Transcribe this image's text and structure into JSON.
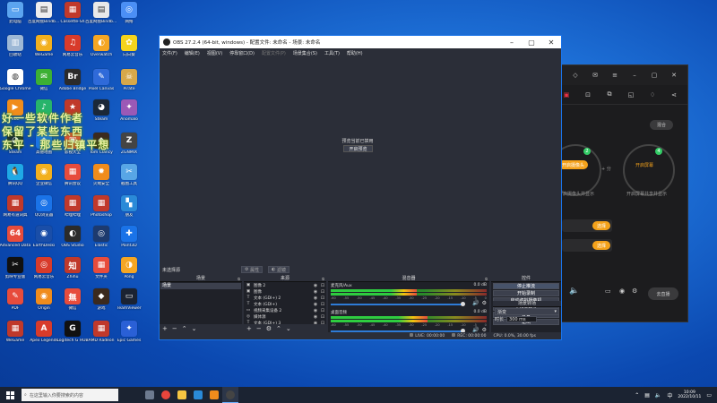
{
  "desktop": {
    "overlay_text": [
      "好一些软件作者",
      "保留了某些东西",
      "东平 - 那些归镇平想"
    ],
    "icons": [
      {
        "label": "此电脑",
        "color": "#5ba4f0",
        "glyph": "▭"
      },
      {
        "label": "百度网盘Bindbgm",
        "color": "#eee",
        "glyph": "▤"
      },
      {
        "label": "Cassette-Sh",
        "color": "#c0392b",
        "glyph": "▦"
      },
      {
        "label": "百度网盘Bindbgm",
        "color": "#e9e9e9",
        "glyph": "▤"
      },
      {
        "label": "网络",
        "color": "#4b8ff5",
        "glyph": "◎"
      },
      {
        "label": "回收站",
        "color": "#9db8d6",
        "glyph": "▥"
      },
      {
        "label": "WeGame",
        "color": "#f2b01e",
        "glyph": "◉"
      },
      {
        "label": "网易云音乐",
        "color": "#d83b2b",
        "glyph": "♫"
      },
      {
        "label": "Overwatch",
        "color": "#f5a623",
        "glyph": "◐"
      },
      {
        "label": "向日葵",
        "color": "#f5d41d",
        "glyph": "✿"
      },
      {
        "label": "Google Chrome",
        "color": "#ffffff",
        "glyph": "◍"
      },
      {
        "label": "微信",
        "color": "#3cb034",
        "glyph": "✉"
      },
      {
        "label": "Adobe Bridge",
        "color": "#2b2b2b",
        "glyph": "Br"
      },
      {
        "label": "Pixel Canvas",
        "color": "#2f6ad9",
        "glyph": "✎"
      },
      {
        "label": "Pirate",
        "color": "#d7a84a",
        "glyph": "☠"
      },
      {
        "label": "VLC",
        "color": "#f08c1c",
        "glyph": "▶"
      },
      {
        "label": "QQ音乐",
        "color": "#27b46b",
        "glyph": "♪"
      },
      {
        "label": "红色警戒",
        "color": "#c0392b",
        "glyph": "★"
      },
      {
        "label": "Steam",
        "color": "#1b2838",
        "glyph": "◕"
      },
      {
        "label": "Anomalo",
        "color": "#9b59b6",
        "glyph": "✦"
      },
      {
        "label": "Steam",
        "color": "#1b2838",
        "glyph": "◕"
      },
      {
        "label": "高德地图",
        "color": "#1a73e8",
        "glyph": "⌖"
      },
      {
        "label": "影视大全",
        "color": "#e74c3c",
        "glyph": "▣"
      },
      {
        "label": "Tom Clancy",
        "color": "#3b2a1e",
        "glyph": "◆"
      },
      {
        "label": "ZGNMIX",
        "color": "#444",
        "glyph": "Z"
      },
      {
        "label": "腾讯QQ",
        "color": "#1fa9e6",
        "glyph": "🐧"
      },
      {
        "label": "企业微信",
        "color": "#f2b01e",
        "glyph": "◉"
      },
      {
        "label": "腾讯会议",
        "color": "#e74c3c",
        "glyph": "▦"
      },
      {
        "label": "火绒安全",
        "color": "#f08c1c",
        "glyph": "✹"
      },
      {
        "label": "截图工具",
        "color": "#58a6e6",
        "glyph": "✂"
      },
      {
        "label": "网易有道词典",
        "color": "#c0392b",
        "glyph": "▦"
      },
      {
        "label": "QQ浏览器",
        "color": "#1a73e8",
        "glyph": "◎"
      },
      {
        "label": "哔哩哔哩",
        "color": "#c0392b",
        "glyph": "▦"
      },
      {
        "label": "Photoshop",
        "color": "#c0392b",
        "glyph": "▦"
      },
      {
        "label": "朋友",
        "color": "#2a8ad8",
        "glyph": "▚"
      },
      {
        "label": "Advanced Data",
        "color": "#e74c3c",
        "glyph": "64"
      },
      {
        "label": "EarthDeski",
        "color": "#1a4ea8",
        "glyph": "◉"
      },
      {
        "label": "OBS Studio",
        "color": "#2b2b2b",
        "glyph": "◐"
      },
      {
        "label": "Elastic",
        "color": "#1d3a6e",
        "glyph": "◎"
      },
      {
        "label": "Paint3D",
        "color": "#1a73e8",
        "glyph": "✚"
      },
      {
        "label": "剪映专业版",
        "color": "#111",
        "glyph": "✂"
      },
      {
        "label": "网易云音乐",
        "color": "#d83b2b",
        "glyph": "◎"
      },
      {
        "label": "Zhihu",
        "color": "#c0392b",
        "glyph": "知"
      },
      {
        "label": "文件夹",
        "color": "#e74c3c",
        "glyph": "▦"
      },
      {
        "label": "Pong",
        "color": "#f5a623",
        "glyph": "◑"
      },
      {
        "label": "PDF",
        "color": "#e74c3c",
        "glyph": "✎"
      },
      {
        "label": "Origin",
        "color": "#f08c1c",
        "glyph": "◉"
      },
      {
        "label": "微信",
        "color": "#e74c3c",
        "glyph": "無"
      },
      {
        "label": "游戏",
        "color": "#3b2a1e",
        "glyph": "◆"
      },
      {
        "label": "TeamViewer",
        "color": "#1b2332",
        "glyph": "▭"
      },
      {
        "label": "WeGame",
        "color": "#c0392b",
        "glyph": "▦"
      },
      {
        "label": "Apex Legends",
        "color": "#d83b2b",
        "glyph": "A"
      },
      {
        "label": "Logitech G HUB",
        "color": "#111",
        "glyph": "G"
      },
      {
        "label": "AMD Radeon",
        "color": "#c0392b",
        "glyph": "▦"
      },
      {
        "label": "Epic Games",
        "color": "#2a60d6",
        "glyph": "✦"
      }
    ]
  },
  "bg_app": {
    "pill": "混合",
    "btn_left": "开启摄像头",
    "btn_right": "开启屏幕",
    "label_left": "开启摄像头并显示",
    "label_right": "开启屏幕共享并显示",
    "option1": "选择",
    "option2": "选择",
    "go_live": "去直播"
  },
  "obs": {
    "title": "OBS 27.2.4 (64-bit, windows) - 配置文件: 未命名 - 场景: 未命名",
    "menu": [
      "文件(F)",
      "编辑(E)",
      "视图(V)",
      "停靠窗口(D)",
      "配置文件(P)",
      "场景集合(S)",
      "工具(T)",
      "帮助(H)"
    ],
    "preview_msg": "预览当前已禁用",
    "preview_btn": "开启预览",
    "no_source": "未选择源",
    "tb_props": "属性",
    "tb_filters": "滤镜",
    "docks": {
      "scenes": "场景",
      "sources": "来源",
      "mixer": "混音器",
      "transitions": "场景转场",
      "controls": "控件"
    },
    "scenes": [
      "场景"
    ],
    "sources": [
      {
        "icon": "▣",
        "name": "图像 2"
      },
      {
        "icon": "▣",
        "name": "图像"
      },
      {
        "icon": "T",
        "name": "文本 (GDI+) 2"
      },
      {
        "icon": "T",
        "name": "文本 (GDI+)"
      },
      {
        "icon": "▭",
        "name": "视频采集设备 2"
      },
      {
        "icon": "◎",
        "name": "媒体源"
      },
      {
        "icon": "T",
        "name": "文本 (GDI+) 3"
      },
      {
        "icon": "▭",
        "name": "显示器采集"
      }
    ],
    "mixer": [
      {
        "name": "麦克风/Aux",
        "db": "0.0 dB",
        "level": 0.55
      },
      {
        "name": "桌面音频",
        "db": "0.0 dB",
        "level": 0.62
      }
    ],
    "meter_scale": [
      "-60",
      "-55",
      "-50",
      "-45",
      "-40",
      "-35",
      "-30",
      "-25",
      "-20",
      "-15",
      "-10",
      "-5",
      "0"
    ],
    "controls": [
      "停止推流",
      "开始录制",
      "启动虚拟摄像机",
      "工作室模式",
      "设置",
      "退出"
    ],
    "transition_type": "渐变",
    "duration_label": "时长",
    "duration_value": "300 ms",
    "status": {
      "live_label": "LIVE:",
      "live_time": "00:00:00",
      "rec_label": "REC:",
      "rec_time": "00:00:00",
      "cpu": "CPU: 0.0%, 30.00 fps"
    }
  },
  "taskbar": {
    "search_placeholder": "在这里输入你要搜索的内容",
    "apps": [
      {
        "name": "task-view",
        "color": "#6d7a8f"
      },
      {
        "name": "chrome",
        "color": "#e8453c"
      },
      {
        "name": "file-explorer",
        "color": "#f5c542"
      },
      {
        "name": "store",
        "color": "#2a8ad8"
      },
      {
        "name": "app-orange",
        "color": "#f08c1c"
      },
      {
        "name": "obs",
        "color": "#444"
      }
    ],
    "time": "10:09",
    "date": "2022/10/11",
    "ime": "中"
  }
}
